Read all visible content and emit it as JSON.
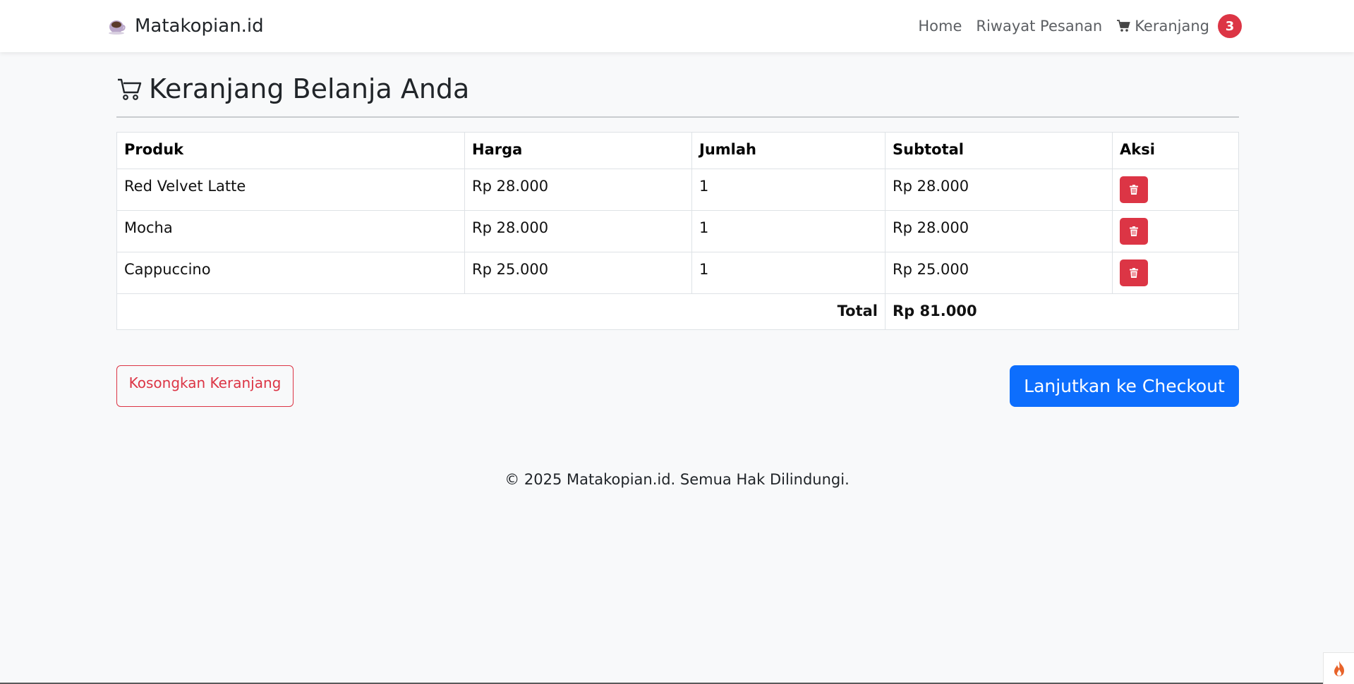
{
  "navbar": {
    "brand": "Matakopian.id",
    "links": {
      "home": "Home",
      "history": "Riwayat Pesanan",
      "cart": "Keranjang",
      "cart_count": "3"
    }
  },
  "page": {
    "title": "Keranjang Belanja Anda"
  },
  "table": {
    "headers": {
      "product": "Produk",
      "price": "Harga",
      "qty": "Jumlah",
      "subtotal": "Subtotal",
      "action": "Aksi"
    },
    "rows": [
      {
        "product": "Red Velvet Latte",
        "price": "Rp 28.000",
        "qty": "1",
        "subtotal": "Rp 28.000"
      },
      {
        "product": "Mocha",
        "price": "Rp 28.000",
        "qty": "1",
        "subtotal": "Rp 28.000"
      },
      {
        "product": "Cappuccino",
        "price": "Rp 25.000",
        "qty": "1",
        "subtotal": "Rp 25.000"
      }
    ],
    "total_label": "Total",
    "total_value": "Rp 81.000"
  },
  "actions": {
    "clear": "Kosongkan Keranjang",
    "checkout": "Lanjutkan ke Checkout"
  },
  "footer": {
    "text": "© 2025 Matakopian.id. Semua Hak Dilindungi."
  },
  "icons": {
    "brand": "coffee-cup-icon",
    "cart": "cart-icon",
    "delete": "trash-icon",
    "corner": "flame-icon"
  },
  "colors": {
    "danger": "#dc3545",
    "primary": "#0d6efd",
    "background": "#f8f9fa"
  }
}
